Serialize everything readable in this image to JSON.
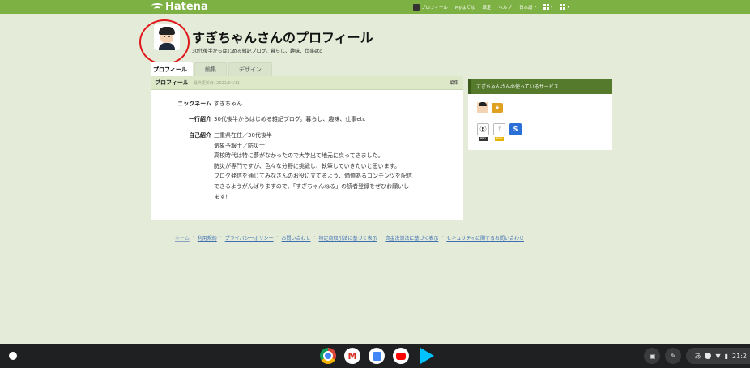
{
  "app": {
    "logo_text": "Hatena"
  },
  "topnav": {
    "profile": "プロフィール",
    "my_hatena": "Myはてな",
    "settings": "設定",
    "help": "ヘルプ",
    "language": "日本語"
  },
  "profile": {
    "title": "すぎちゃんさんのプロフィール",
    "subtitle": "30代後半からはじめる雑記ブログ。暮らし、趣味、仕事etc"
  },
  "tabs": [
    {
      "label": "プロフィール"
    },
    {
      "label": "編集"
    },
    {
      "label": "デザイン"
    }
  ],
  "card": {
    "heading": "プロフィール",
    "updated": "最終更新日: 2021/04/11",
    "edit": "編集",
    "rows": {
      "nickname_label": "ニックネーム",
      "nickname": "すぎちゃん",
      "oneline_label": "一行紹介",
      "oneline": "30代後半からはじめる雑記ブログ。暮らし、趣味、仕事etc",
      "bio_label": "自己紹介",
      "bio_lines": [
        "三重県在住／30代後半",
        "気象予報士／防災士",
        "高校時代は特に夢がなかったので大学出て地元に戻ってきました。",
        "防災が専門ですが、色々な分野に挑戦し、執筆していきたいと思います。",
        "ブログ発信を通じてみなさんのお役に立てるよう、価値あるコンテンツを配信",
        "できるようがんばりますので、「すぎちゃんねる」の読者登録をぜひお願いし",
        "ます！"
      ]
    }
  },
  "services": {
    "heading": "すぎちゃんさんの使っているサービス",
    "badges": {
      "pro": "PRO",
      "max": "MAX"
    }
  },
  "footer": {
    "links": [
      "ホーム",
      "利用規約",
      "プライバシーポリシー",
      "お問い合わせ",
      "特定商取引法に基づく表示",
      "資金決済法に基づく表示",
      "セキュリティに関するお問い合わせ"
    ]
  },
  "taskbar": {
    "ime": "あ",
    "time": "21:2"
  },
  "colors": {
    "brand_green": "#7db143",
    "page_bg": "#e4ecd9",
    "annotation_red": "#e0181b"
  }
}
